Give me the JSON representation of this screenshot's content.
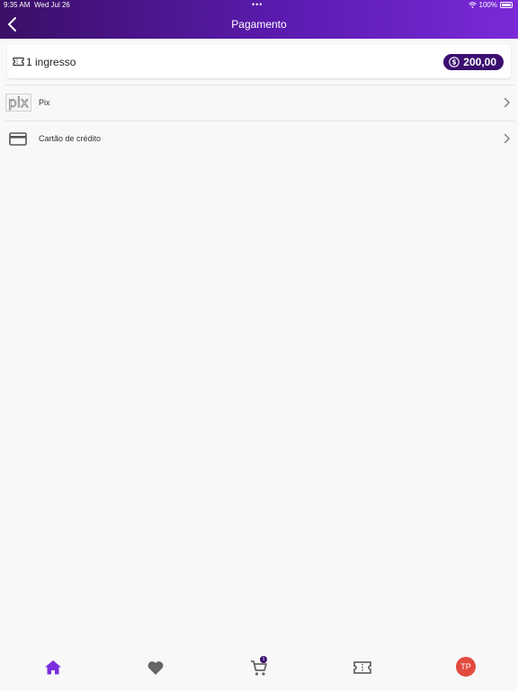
{
  "status_bar": {
    "time": "9:35 AM",
    "date": "Wed Jul 26",
    "dots": "•••",
    "battery": "100%"
  },
  "header": {
    "title": "Pagamento",
    "back_icon": "chevron-left-icon"
  },
  "summary": {
    "ticket_label": "1 ingresso",
    "price": "200,00"
  },
  "payment_methods": [
    {
      "label": "Pix",
      "icon": "pix-logo"
    },
    {
      "label": "Cartão de crédito",
      "icon": "credit-card-icon"
    }
  ],
  "bottom_nav": {
    "tabs": [
      {
        "icon": "home-icon",
        "active": true
      },
      {
        "icon": "heart-icon",
        "active": false
      },
      {
        "icon": "cart-icon",
        "active": false,
        "badge": "1"
      },
      {
        "icon": "ticket-icon",
        "active": false
      },
      {
        "icon": "avatar",
        "active": false
      }
    ],
    "avatar_initials": "TP"
  },
  "colors": {
    "header_gradient_start": "#3a0f66",
    "header_gradient_end": "#7a2ad8",
    "accent": "#3b0f6e",
    "active_tab": "#7b2fe0",
    "avatar_bg": "#e34b3f"
  }
}
